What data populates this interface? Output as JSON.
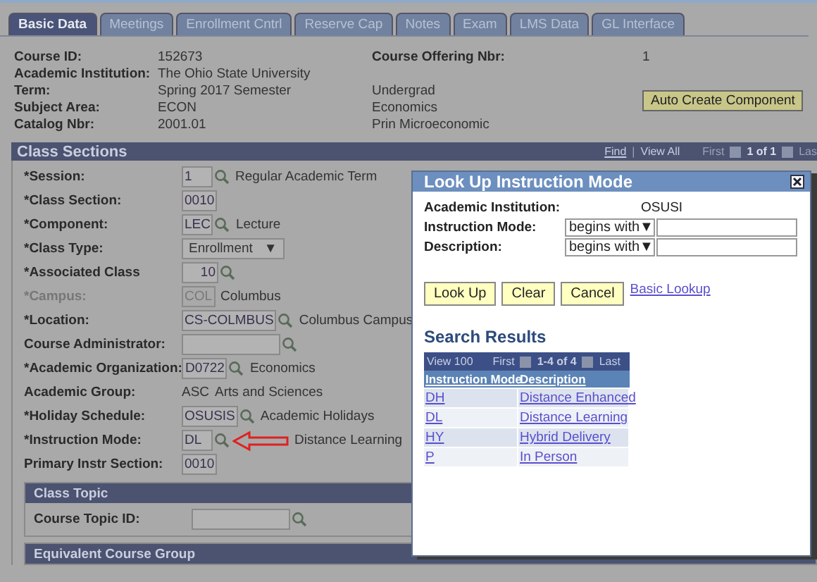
{
  "tabs": [
    {
      "label": "Basic Data",
      "selected": true
    },
    {
      "label": "Meetings",
      "selected": false
    },
    {
      "label": "Enrollment Cntrl",
      "selected": false
    },
    {
      "label": "Reserve Cap",
      "selected": false
    },
    {
      "label": "Notes",
      "selected": false
    },
    {
      "label": "Exam",
      "selected": false
    },
    {
      "label": "LMS Data",
      "selected": false
    },
    {
      "label": "GL Interface",
      "selected": false
    }
  ],
  "header": {
    "rows": [
      {
        "label": "Course ID:",
        "value": "152673"
      },
      {
        "label": "Academic Institution:",
        "value": "The Ohio State University"
      },
      {
        "label": "Term:",
        "value": "Spring 2017 Semester"
      },
      {
        "label": "Subject Area:",
        "value": "ECON"
      },
      {
        "label": "Catalog Nbr:",
        "value": "2001.01"
      }
    ],
    "offering": {
      "label": "Course Offering Nbr:",
      "value": "1"
    },
    "notes": [
      "Undergrad",
      "Economics",
      "Prin Microeconomic"
    ],
    "button": "Auto Create Component"
  },
  "class_sections": {
    "title": "Class Sections",
    "nav": {
      "find": "Find",
      "separator": "|",
      "view_all": "View All",
      "first": "First",
      "count": "1 of 1",
      "last": "Las"
    },
    "fields": [
      {
        "label": "*Session:",
        "kind": "input",
        "value": "1",
        "lookup": true,
        "disabled": false,
        "arrow": false,
        "description": "Regular Academic Term"
      },
      {
        "label": "*Class Section:",
        "kind": "input",
        "value": "0010",
        "lookup": false,
        "disabled": false,
        "arrow": false
      },
      {
        "label": "*Component:",
        "kind": "input",
        "value": "LEC",
        "lookup": true,
        "disabled": false,
        "arrow": false,
        "description": "Lecture"
      },
      {
        "label": "*Class Type:",
        "kind": "select",
        "value": "Enrollment",
        "caret": "▼",
        "lookup": false,
        "disabled": false,
        "arrow": false
      },
      {
        "label": "*Associated Class",
        "kind": "number",
        "value": "10",
        "lookup": true,
        "disabled": false,
        "arrow": false
      },
      {
        "label": "*Campus:",
        "kind": "input",
        "value": "COL",
        "lookup": false,
        "disabled": true,
        "arrow": false,
        "description": "Columbus"
      },
      {
        "label": "*Location:",
        "kind": "input",
        "value": "CS-COLMBUS",
        "lookup": true,
        "disabled": false,
        "arrow": false,
        "description": "Columbus Campus"
      },
      {
        "label": "Course Administrator:",
        "kind": "input",
        "lookup": true,
        "disabled": false,
        "arrow": false
      },
      {
        "label": "*Academic Organization:",
        "kind": "input",
        "value": "D0722",
        "lookup": true,
        "disabled": false,
        "arrow": false,
        "description": "Economics"
      },
      {
        "label": "Academic Group:",
        "kind": "text",
        "value": "ASC",
        "lookup": false,
        "disabled": false,
        "arrow": false,
        "description": "Arts and Sciences"
      },
      {
        "label": "*Holiday Schedule:",
        "kind": "input",
        "value": "OSUSIS",
        "lookup": true,
        "disabled": false,
        "arrow": false,
        "description": "Academic Holidays"
      },
      {
        "label": "*Instruction Mode:",
        "kind": "input",
        "value": "DL",
        "lookup": true,
        "disabled": false,
        "arrow": true,
        "description": "Distance Learning"
      },
      {
        "label": "Primary Instr Section:",
        "kind": "input",
        "value": "0010",
        "lookup": false,
        "disabled": false,
        "arrow": false
      }
    ],
    "subsections": [
      {
        "title": "Class Topic",
        "fields": [
          {
            "label": "Course Topic ID:",
            "kind": "input",
            "lookup": true,
            "disabled": false,
            "arrow": false
          }
        ]
      },
      {
        "title": "Equivalent Course Group"
      }
    ]
  },
  "modal": {
    "title": "Look Up Instruction Mode",
    "institution": {
      "label": "Academic Institution:",
      "value": "OSUSI"
    },
    "criteria": [
      {
        "label": "Instruction Mode:",
        "operator": "begins with",
        "caret": "▼"
      },
      {
        "label": "Description:",
        "operator": "begins with",
        "caret": "▼"
      }
    ],
    "buttons": [
      "Look Up",
      "Clear",
      "Cancel"
    ],
    "link": "Basic Lookup",
    "results": {
      "title": "Search Results",
      "nav": {
        "view": "View 100",
        "first": "First",
        "count": "1-4 of 4",
        "last": "Last"
      },
      "columns": [
        "Instruction Mode",
        "Description"
      ],
      "rows": [
        [
          "DH",
          "Distance Enhanced"
        ],
        [
          "DL",
          "Distance Learning"
        ],
        [
          "HY",
          "Hybrid Delivery"
        ],
        [
          "P",
          "In Person"
        ]
      ]
    }
  }
}
